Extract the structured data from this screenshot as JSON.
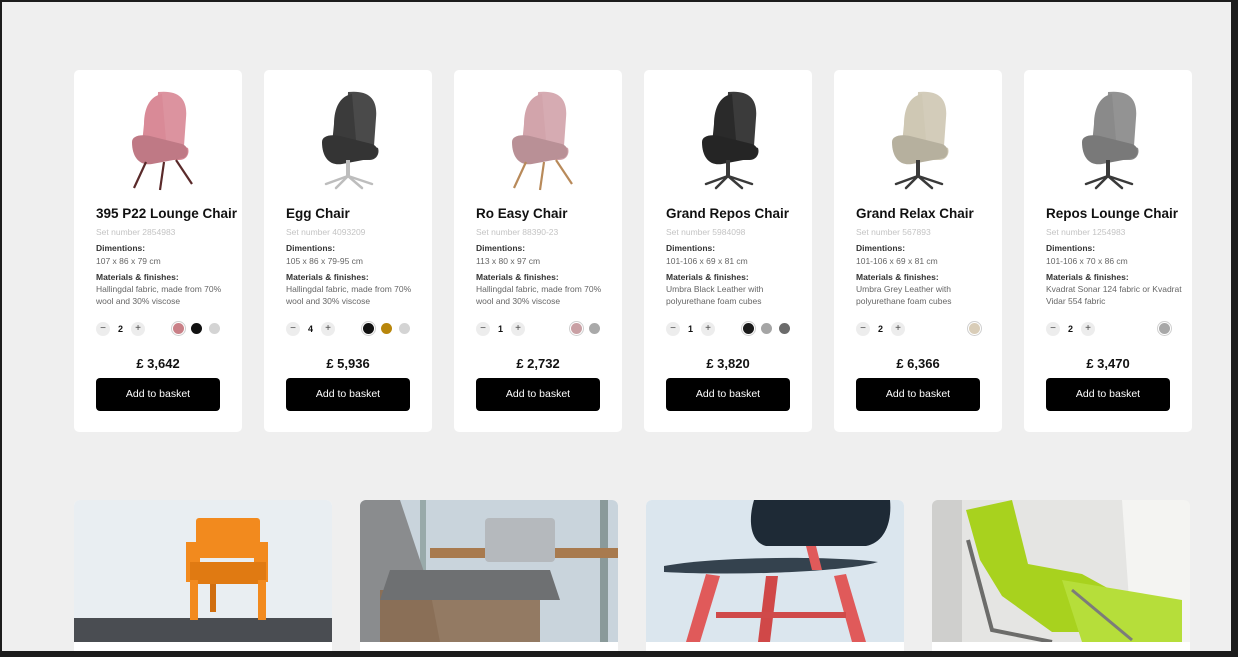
{
  "labels": {
    "dimensions": "Dimentions:",
    "materials": "Materials & finishes:",
    "add_to_basket": "Add to basket",
    "minus": "−",
    "plus": "+"
  },
  "products": [
    {
      "name": "395 P22 Lounge Chair",
      "set_number": "Set number 2854983",
      "dimensions": "107 x 86 x 79 cm",
      "materials": "Hallingdal fabric, made from 70% wool and 30% viscose",
      "quantity": "2",
      "price": "£ 3,642",
      "swatches": [
        "#c98087",
        "#111111",
        "#d4d4d4"
      ],
      "selected_swatch": 0,
      "chair_color": "#d98a97",
      "base": "legs-dark"
    },
    {
      "name": "Egg Chair",
      "set_number": "Set number 4093209",
      "dimensions": "105 x 86 x 79-95 cm",
      "materials": "Hallingdal fabric, made from 70% wool and 30% viscose",
      "quantity": "4",
      "price": "£ 5,936",
      "swatches": [
        "#111111",
        "#b8860b",
        "#d4d4d4"
      ],
      "selected_swatch": 0,
      "chair_color": "#3b3b3b",
      "base": "star-silver"
    },
    {
      "name": "Ro Easy Chair",
      "set_number": "Set number 88390-23",
      "dimensions": "113 x 80 x 97 cm",
      "materials": "Hallingdal fabric, made from 70% wool and 30% viscose",
      "quantity": "1",
      "price": "£ 2,732",
      "swatches": [
        "#c9a0a4",
        "#a9a9a9"
      ],
      "selected_swatch": 0,
      "chair_color": "#d2a4ab",
      "base": "legs-wood"
    },
    {
      "name": "Grand Repos Chair",
      "set_number": "Set number 5984098",
      "dimensions": "101-106 x 69 x 81 cm",
      "materials": "Umbra Black Leather with polyurethane foam cubes",
      "quantity": "1",
      "price": "£ 3,820",
      "swatches": [
        "#1a1a1a",
        "#a5a5a5",
        "#6b6b6b"
      ],
      "selected_swatch": 0,
      "chair_color": "#2a2a2a",
      "base": "star-dark"
    },
    {
      "name": "Grand Relax Chair",
      "set_number": "Set number 567893",
      "dimensions": "101-106 x 69 x 81 cm",
      "materials": "Umbra Grey Leather with polyurethane foam cubes",
      "quantity": "2",
      "price": "£ 6,366",
      "swatches": [
        "#d9cdb8"
      ],
      "selected_swatch": 0,
      "chair_color": "#cfc8b4",
      "base": "star-dark"
    },
    {
      "name": "Repos Lounge Chair",
      "set_number": "Set number 1254983",
      "dimensions": "101-106 x 70 x 86 cm",
      "materials": "Kvadrat Sonar 124 fabric or Kvadrat Vidar 554 fabric",
      "quantity": "2",
      "price": "£ 3,470",
      "swatches": [
        "#a8a8a8"
      ],
      "selected_swatch": 0,
      "chair_color": "#8a8a8a",
      "base": "star-dark"
    }
  ],
  "gallery": [
    {
      "subject": "orange-plastic-armchair",
      "bg": "#e9eef2",
      "floor": "#4a4d52",
      "accent": "#f28a1e"
    },
    {
      "subject": "office-chairs-at-table",
      "bg": "#c9d4dc",
      "floor": "#8a6a4e",
      "accent": "#7a7a7a"
    },
    {
      "subject": "red-black-chair-closeup",
      "bg": "#dbe6ee",
      "floor": "#e6edf3",
      "accent": "#e05a5a"
    },
    {
      "subject": "lime-green-lounge-chair",
      "bg": "#e5e5e3",
      "floor": "#d8d8d6",
      "accent": "#a8d21e"
    }
  ]
}
